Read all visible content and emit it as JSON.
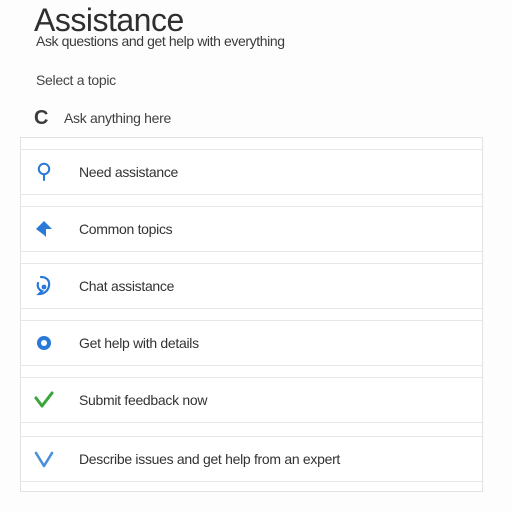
{
  "header": {
    "title": "Assistance",
    "subtitle": "Ask questions and get help with everything"
  },
  "section": {
    "label": "Select a topic"
  },
  "search": {
    "text": "Ask anything here"
  },
  "colors": {
    "accent_blue": "#2979d9",
    "accent_green": "#3aa53a",
    "light_blue": "#4a8fdc"
  },
  "list": {
    "items": [
      {
        "label": "Need assistance",
        "icon": "location-pin-icon"
      },
      {
        "label": "Common topics",
        "icon": "diamond-arrow-icon"
      },
      {
        "label": "Chat assistance",
        "icon": "chat-bubble-icon"
      },
      {
        "label": "Get help with details",
        "icon": "radio-dot-icon"
      },
      {
        "label": "Submit feedback now",
        "icon": "checkmark-icon"
      },
      {
        "label": "Describe issues and get help from an expert",
        "icon": "chevron-down-icon"
      }
    ]
  }
}
